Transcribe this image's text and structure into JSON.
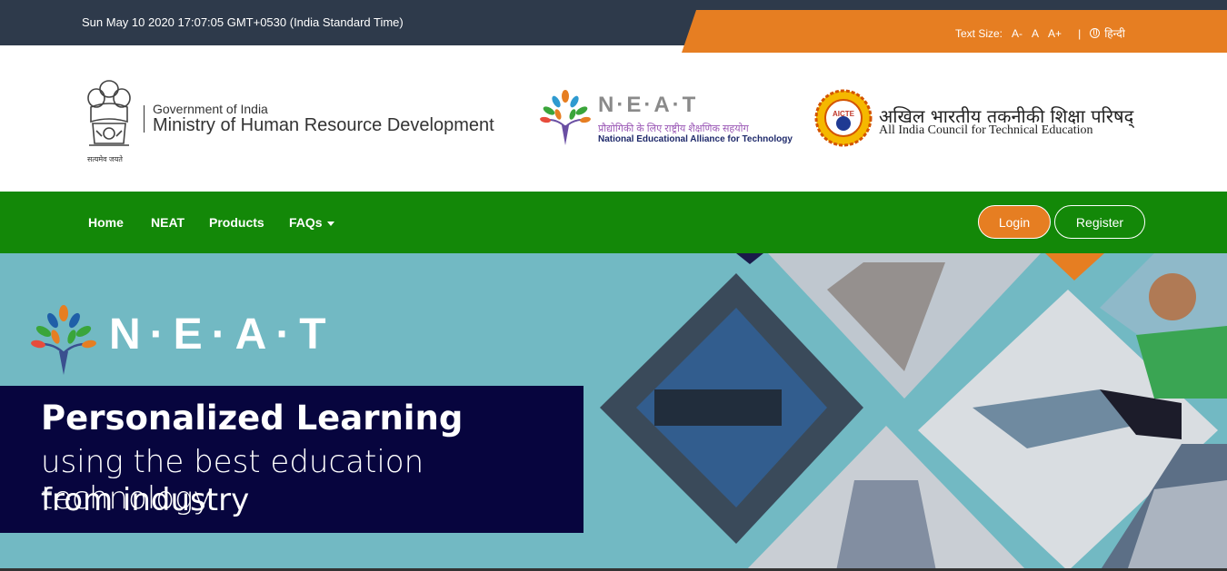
{
  "topbar": {
    "datetime": "Sun May 10 2020 17:07:05 GMT+0530 (India Standard Time)",
    "text_size_label": "Text Size:",
    "ts_small": "A-",
    "ts_normal": "A",
    "ts_large": "A+",
    "separator": "|",
    "language": "हिन्दी"
  },
  "header": {
    "emblem_caption": "सत्यमेव जयते",
    "gov_line1": "Government of India",
    "gov_line2": "Ministry of Human Resource Development",
    "neat_title": "N·E·A·T",
    "neat_hindi": "प्रौद्योगिकी के लिए राष्ट्रीय शैक्षणिक सहयोग",
    "neat_english": "National Educational Alliance for Technology",
    "aicte_badge": "AICTE",
    "aicte_hindi": "अखिल भारतीय तकनीकी शिक्षा परिषद्",
    "aicte_english": "All India Council for Technical Education"
  },
  "nav": {
    "home": "Home",
    "neat": "NEAT",
    "products": "Products",
    "faqs": "FAQs",
    "login": "Login",
    "register": "Register"
  },
  "hero": {
    "logo_text": "N·E·A·T",
    "title": "Personalized Learning",
    "sub1": "using the best education technology",
    "sub2": "from industry"
  },
  "colors": {
    "topbar_dark": "#2e3a4b",
    "orange": "#e67e22",
    "nav_green": "#138808",
    "hero_bg": "#72b9c3",
    "hero_box": "#07053e"
  }
}
